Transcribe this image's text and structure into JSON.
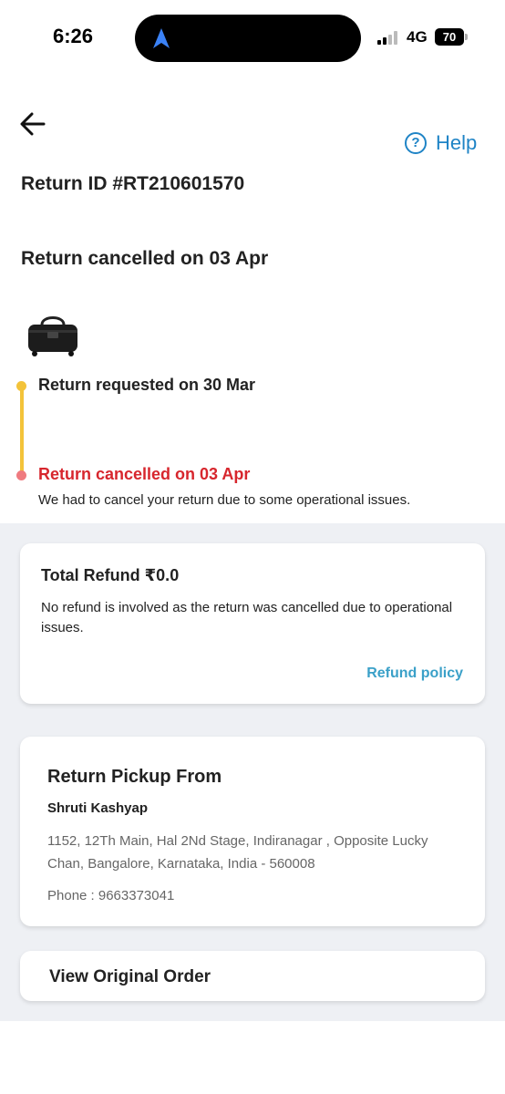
{
  "status_bar": {
    "time": "6:26",
    "network": "4G",
    "battery": "70"
  },
  "header": {
    "help_label": "Help"
  },
  "return": {
    "id_text": "Return ID #RT210601570",
    "status_title": "Return cancelled on 03 Apr"
  },
  "timeline": {
    "steps": [
      {
        "label": "Return requested on 30 Mar"
      },
      {
        "label": "Return cancelled on 03 Apr",
        "note": "We had to cancel your return due to some operational issues."
      }
    ]
  },
  "refund": {
    "title": "Total Refund ₹0.0",
    "description": "No refund is involved as the return was cancelled due to operational issues.",
    "policy_link": "Refund policy"
  },
  "pickup": {
    "title": "Return Pickup From",
    "name": "Shruti Kashyap",
    "address": "1152, 12Th Main, Hal 2Nd Stage, Indiranagar , Opposite Lucky Chan, Bangalore, Karnataka, India - 560008",
    "phone": "Phone : 9663373041"
  },
  "view_order": {
    "label": "View Original Order"
  },
  "colors": {
    "accent_blue": "#1f84c6",
    "link_blue": "#3aa0c8",
    "cancel_red": "#d7262d",
    "timeline_yellow": "#f3c33a",
    "timeline_pink": "#ef7b80",
    "section_grey": "#eef0f4"
  },
  "icons": {
    "back": "arrow-left-icon",
    "help": "question-circle-icon",
    "navigation": "location-arrow-icon"
  }
}
